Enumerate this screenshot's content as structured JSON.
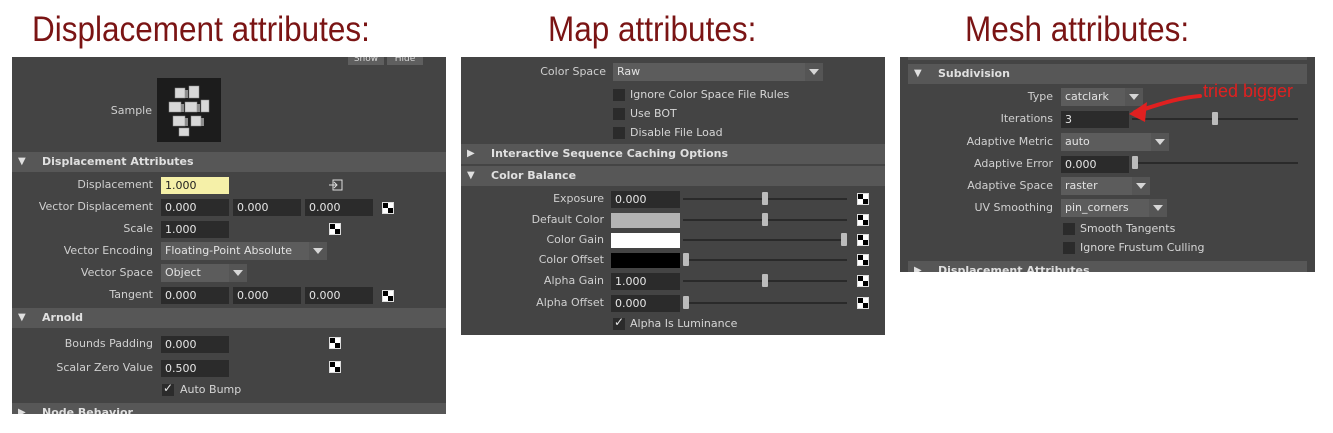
{
  "headings": {
    "displacement": "Displacement attributes:",
    "map": "Map attributes:",
    "mesh": "Mesh attributes:"
  },
  "displacement_panel": {
    "top_buttons": [
      "Show",
      "Hide"
    ],
    "sample_label": "Sample",
    "section_title": "Displacement Attributes",
    "rows": {
      "displacement": {
        "label": "Displacement",
        "value": "1.000"
      },
      "vector_displacement": {
        "label": "Vector Displacement",
        "values": [
          "0.000",
          "0.000",
          "0.000"
        ]
      },
      "scale": {
        "label": "Scale",
        "value": "1.000"
      },
      "vector_encoding": {
        "label": "Vector Encoding",
        "value": "Floating-Point Absolute"
      },
      "vector_space": {
        "label": "Vector Space",
        "value": "Object"
      },
      "tangent": {
        "label": "Tangent",
        "values": [
          "0.000",
          "0.000",
          "0.000"
        ]
      }
    },
    "arnold_section": "Arnold",
    "bounds_padding": {
      "label": "Bounds Padding",
      "value": "0.000"
    },
    "scalar_zero_value": {
      "label": "Scalar Zero Value",
      "value": "0.500"
    },
    "auto_bump": {
      "label": "Auto Bump",
      "checked": true
    },
    "node_behavior_section": "Node Behavior"
  },
  "map_panel": {
    "color_space": {
      "label": "Color Space",
      "value": "Raw"
    },
    "ignore_rules": {
      "label": "Ignore Color Space File Rules",
      "checked": false
    },
    "use_bot": {
      "label": "Use BOT",
      "checked": false
    },
    "disable_file_load": {
      "label": "Disable File Load",
      "checked": false
    },
    "section_caching": "Interactive Sequence Caching Options",
    "section_color_balance": "Color Balance",
    "exposure": {
      "label": "Exposure",
      "value": "0.000",
      "slider": 0.5
    },
    "default_color": {
      "label": "Default Color",
      "color": "#b4b4b4",
      "slider": 0.5
    },
    "color_gain": {
      "label": "Color Gain",
      "color": "#ffffff",
      "slider": 1.0
    },
    "color_offset": {
      "label": "Color Offset",
      "color": "#000000",
      "slider": 0.0
    },
    "alpha_gain": {
      "label": "Alpha Gain",
      "value": "1.000",
      "slider": 0.5
    },
    "alpha_offset": {
      "label": "Alpha Offset",
      "value": "0.000",
      "slider": 0.0
    },
    "alpha_is_luminance": {
      "label": "Alpha Is Luminance",
      "checked": true
    }
  },
  "mesh_panel": {
    "section_subdivision": "Subdivision",
    "type": {
      "label": "Type",
      "value": "catclark"
    },
    "iterations": {
      "label": "Iterations",
      "value": "3",
      "slider": 0.5
    },
    "adaptive_metric": {
      "label": "Adaptive Metric",
      "value": "auto"
    },
    "adaptive_error": {
      "label": "Adaptive Error",
      "value": "0.000",
      "slider": 0.0
    },
    "adaptive_space": {
      "label": "Adaptive Space",
      "value": "raster"
    },
    "uv_smoothing": {
      "label": "UV Smoothing",
      "value": "pin_corners"
    },
    "smooth_tangents": {
      "label": "Smooth Tangents",
      "checked": false
    },
    "ignore_frustum": {
      "label": "Ignore Frustum Culling",
      "checked": false
    },
    "section_displacement": "Displacement Attributes",
    "annotation": "tried bigger"
  },
  "colors": {
    "heading": "#7a1414",
    "annotation": "#e02020",
    "panel_bg": "#444444",
    "section_bg": "#575757"
  }
}
